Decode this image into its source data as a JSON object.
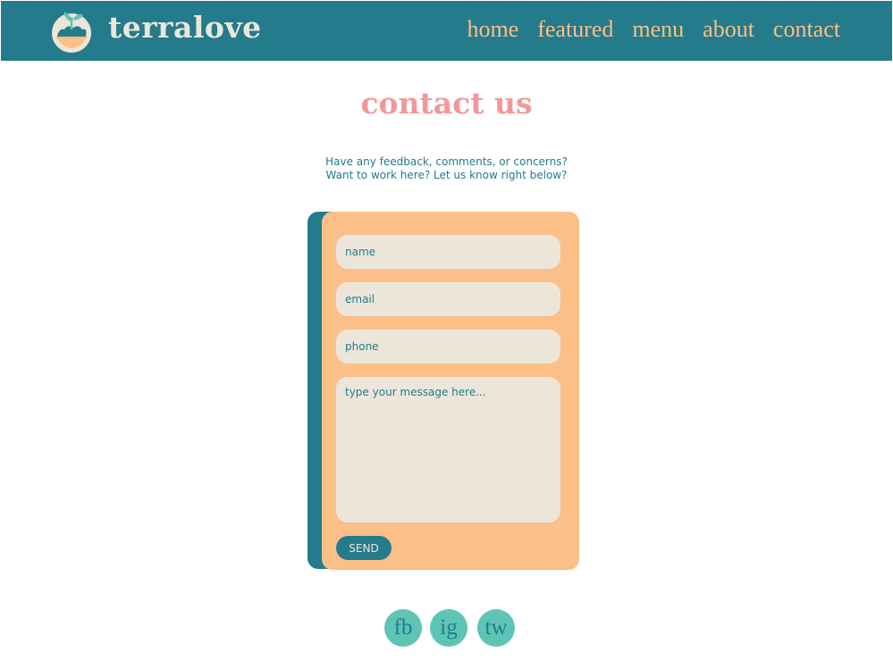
{
  "header": {
    "brand": "terralove",
    "logo_icon": "seedling-bowl-icon",
    "nav": [
      {
        "label": "home"
      },
      {
        "label": "featured"
      },
      {
        "label": "menu"
      },
      {
        "label": "about"
      },
      {
        "label": "contact"
      }
    ]
  },
  "main": {
    "title": "contact us",
    "intro_line1": "Have any feedback, comments, or concerns?",
    "intro_line2": "Want to work here? Let us know right below?"
  },
  "form": {
    "name_placeholder": "name",
    "email_placeholder": "email",
    "phone_placeholder": "phone",
    "message_placeholder": "type your message here...",
    "send_label": "SEND"
  },
  "social": [
    {
      "label": "fb"
    },
    {
      "label": "ig"
    },
    {
      "label": "tw"
    }
  ],
  "colors": {
    "primary_teal": "#247b8c",
    "peach": "#fbbf87",
    "pink": "#f2989a",
    "cream": "#ece6da",
    "mint": "#5ec4b5"
  }
}
